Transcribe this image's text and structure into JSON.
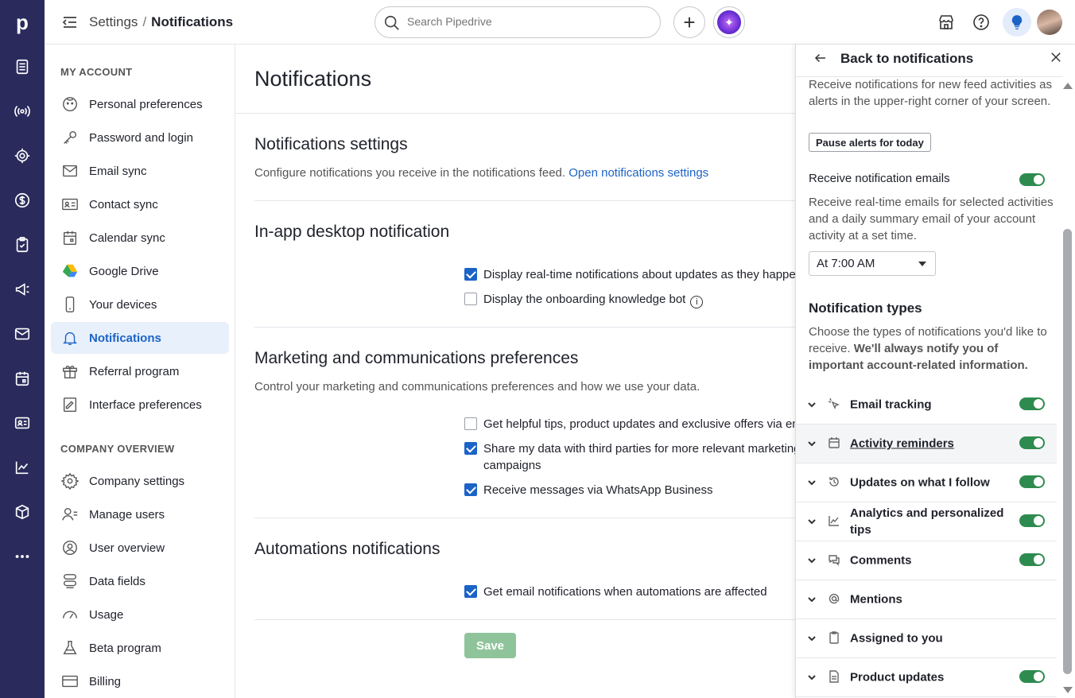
{
  "app": {
    "logo": "p"
  },
  "rail": {
    "icons": [
      "leads-icon",
      "activity-feed-icon",
      "target-icon",
      "deals-icon",
      "tasks-icon",
      "campaigns-icon",
      "mail-icon",
      "calendar-icon",
      "contacts-icon",
      "insights-icon",
      "products-icon",
      "more-icon"
    ]
  },
  "topbar": {
    "breadcrumb_parent": "Settings",
    "breadcrumb_sep": "/",
    "breadcrumb_current": "Notifications",
    "search_placeholder": "Search Pipedrive",
    "add_label": "+"
  },
  "sidebar": {
    "my_account_heading": "MY ACCOUNT",
    "my_account": [
      {
        "label": "Personal preferences",
        "icon": "face-icon"
      },
      {
        "label": "Password and login",
        "icon": "key-icon"
      },
      {
        "label": "Email sync",
        "icon": "envelope-icon"
      },
      {
        "label": "Contact sync",
        "icon": "contact-card-icon"
      },
      {
        "label": "Calendar sync",
        "icon": "calendar-icon"
      },
      {
        "label": "Google Drive",
        "icon": "google-drive-icon"
      },
      {
        "label": "Your devices",
        "icon": "phone-icon"
      },
      {
        "label": "Notifications",
        "icon": "bell-icon",
        "active": true
      },
      {
        "label": "Referral program",
        "icon": "gift-icon"
      },
      {
        "label": "Interface preferences",
        "icon": "interface-icon"
      }
    ],
    "company_heading": "COMPANY OVERVIEW",
    "company": [
      {
        "label": "Company settings",
        "icon": "gear-icon"
      },
      {
        "label": "Manage users",
        "icon": "users-icon"
      },
      {
        "label": "User overview",
        "icon": "user-circle-icon"
      },
      {
        "label": "Data fields",
        "icon": "data-fields-icon"
      },
      {
        "label": "Usage",
        "icon": "gauge-icon"
      },
      {
        "label": "Beta program",
        "icon": "flask-icon"
      },
      {
        "label": "Billing",
        "icon": "credit-card-icon"
      }
    ]
  },
  "main": {
    "title": "Notifications",
    "notif_settings": {
      "title": "Notifications settings",
      "desc": "Configure notifications you receive in the notifications feed.",
      "link": "Open notifications settings"
    },
    "inapp": {
      "title": "In-app desktop notification",
      "opt1": "Display real-time notifications about updates as they happen",
      "opt1_checked": true,
      "opt2": "Display the onboarding knowledge bot",
      "opt2_checked": false
    },
    "marketing": {
      "title": "Marketing and communications preferences",
      "desc": "Control your marketing and communications preferences and how we use your data.",
      "opt1": "Get helpful tips, product updates and exclusive offers via email",
      "opt1_checked": false,
      "opt2_line1": "Share my data with third parties for more relevant marketing",
      "opt2_line2": "campaigns",
      "opt2_checked": true,
      "opt3": "Receive messages via WhatsApp Business",
      "opt3_checked": true
    },
    "automations": {
      "title": "Automations notifications",
      "opt1": "Get email notifications when automations are affected",
      "opt1_checked": true
    },
    "save_label": "Save"
  },
  "panel": {
    "back_label": "Back to notifications",
    "alerts_desc": "Receive notifications for new feed activities as alerts in the upper-right corner of your screen.",
    "pause_label": "Pause alerts for today",
    "emails_label": "Receive notification emails",
    "emails_on": true,
    "emails_desc": "Receive real-time emails for selected activities and a daily summary email of your account activity at a set time.",
    "time_value": "At 7:00 AM",
    "types_heading": "Notification types",
    "types_desc": "Choose the types of notifications you'd like to receive.",
    "types_desc_bold": "We'll always notify you of important account-related information.",
    "types": [
      {
        "label": "Email tracking",
        "icon": "cursor-click-icon",
        "on": true
      },
      {
        "label": "Activity reminders",
        "icon": "calendar-icon",
        "on": true
      },
      {
        "label": "Updates on what I follow",
        "icon": "history-icon",
        "on": true
      },
      {
        "label": "Analytics and personalized tips",
        "icon": "chart-icon",
        "on": true
      },
      {
        "label": "Comments",
        "icon": "comment-icon",
        "on": true
      },
      {
        "label": "Mentions",
        "icon": "at-icon",
        "on": false
      },
      {
        "label": "Assigned to you",
        "icon": "clipboard-icon",
        "on": false
      },
      {
        "label": "Product updates",
        "icon": "document-icon",
        "on": true
      }
    ]
  }
}
